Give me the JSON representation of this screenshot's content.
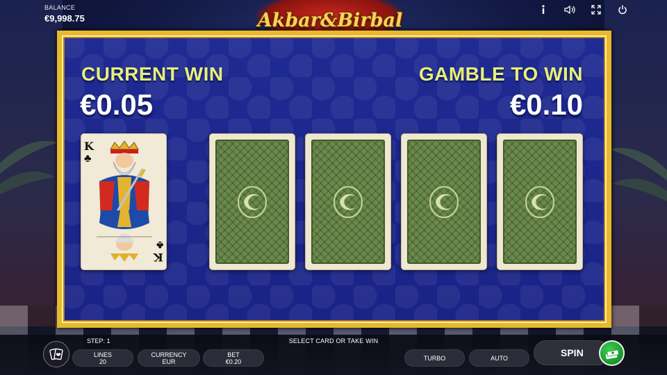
{
  "game": {
    "title": "Akbar&Birbal"
  },
  "top_bar": {
    "balance_label": "BALANCE",
    "balance_value": "€9,998.75",
    "icons": [
      "info-icon",
      "sound-icon",
      "fullscreen-icon",
      "power-icon"
    ]
  },
  "gamble": {
    "current_win_label": "CURRENT WIN",
    "current_win_value": "€0.05",
    "gamble_to_win_label": "GAMBLE TO WIN",
    "gamble_to_win_value": "€0.10",
    "dealer_card": {
      "rank": "K",
      "suit": "♣"
    },
    "face_down_cards": 4
  },
  "bottom_bar": {
    "step_label": "STEP: 1",
    "status_message": "SELECT CARD OR TAKE WIN",
    "lines": {
      "label": "LINES",
      "value": "20"
    },
    "currency": {
      "label": "CURRENCY",
      "value": "EUR"
    },
    "bet": {
      "label": "BET",
      "value": "€0.20"
    },
    "turbo_label": "TURBO",
    "auto_label": "AUTO",
    "spin_label": "SPIN"
  },
  "colors": {
    "panel_blue": "#1f2a93",
    "gold_frame": "#e7b92e",
    "win_label": "#e6f07a",
    "card_back_green": "#6a8a4c",
    "take_win_green": "#16962a"
  }
}
